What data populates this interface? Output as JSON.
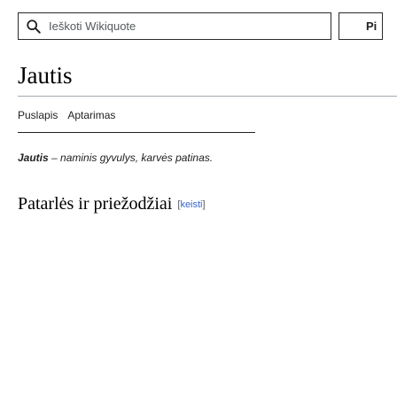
{
  "search": {
    "placeholder": "Ieškoti Wikiquote",
    "button_label": "Pi"
  },
  "page": {
    "title": "Jautis"
  },
  "tabs": [
    {
      "label": "Puslapis"
    },
    {
      "label": "Aptarimas"
    }
  ],
  "intro": {
    "term": "Jautis",
    "definition": " – naminis gyvulys, karvės patinas."
  },
  "section": {
    "heading": "Patarlės ir priežodžiai",
    "edit_open": "[",
    "edit_label": "keisti",
    "edit_close": "]"
  }
}
